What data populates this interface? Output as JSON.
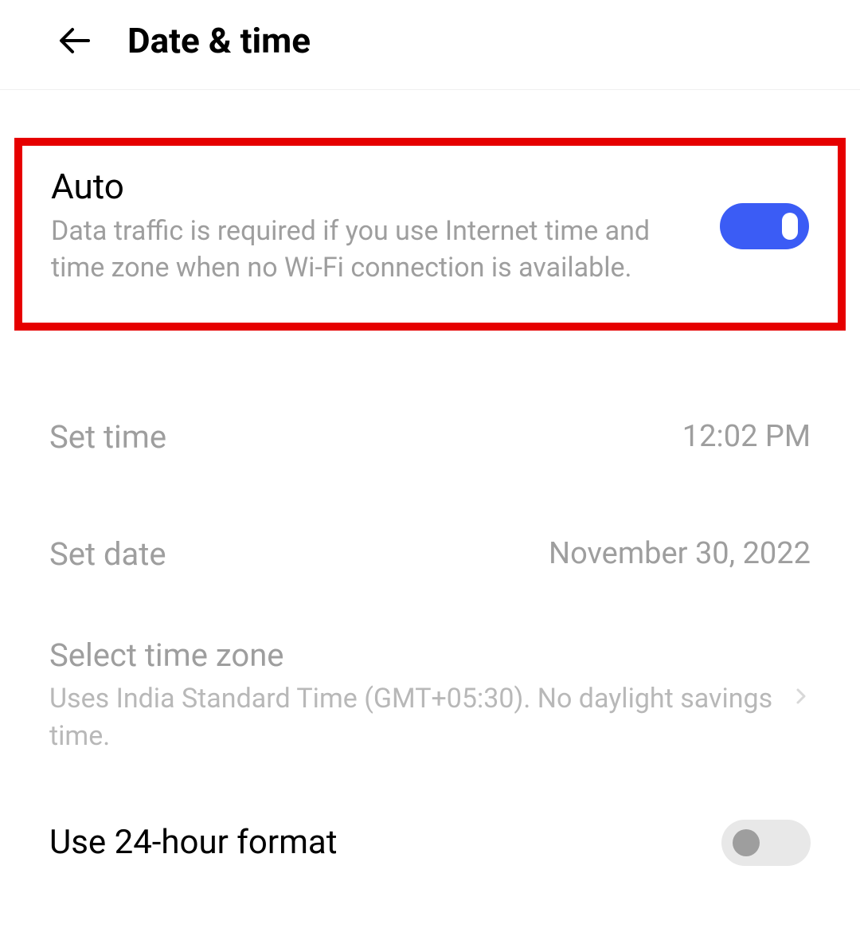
{
  "header": {
    "title": "Date & time"
  },
  "auto": {
    "title": "Auto",
    "desc": "Data traffic is required if you use Internet time and time zone when no Wi-Fi connection is available.",
    "enabled": true
  },
  "set_time": {
    "label": "Set time",
    "value": "12:02 PM"
  },
  "set_date": {
    "label": "Set date",
    "value": "November 30, 2022"
  },
  "timezone": {
    "title": "Select time zone",
    "desc": "Uses India Standard Time (GMT+05:30). No daylight savings time."
  },
  "format24": {
    "label": "Use 24-hour format",
    "enabled": false
  }
}
